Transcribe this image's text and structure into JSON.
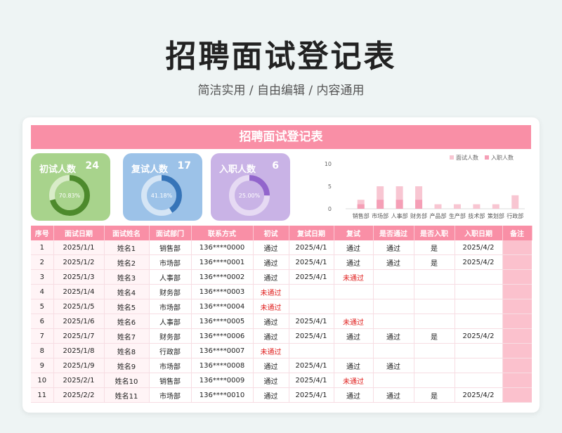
{
  "header": {
    "title": "招聘面试登记表",
    "subtitle": "简洁实用 / 自由编辑 / 内容通用"
  },
  "sheet": {
    "title": "招聘面试登记表"
  },
  "stats": [
    {
      "label": "初试人数",
      "value": "24",
      "percent_text": "70.83%",
      "fraction": 0.7083,
      "color": "#a8d38c",
      "ring": "#4d8a2c",
      "track": "#d9ecc9"
    },
    {
      "label": "复试人数",
      "value": "17",
      "percent_text": "41.18%",
      "fraction": 0.4118,
      "color": "#9cc2e8",
      "ring": "#3674b8",
      "track": "#d5e5f5"
    },
    {
      "label": "入职人数",
      "value": "6",
      "percent_text": "25.00%",
      "fraction": 0.25,
      "color": "#c9b3e6",
      "ring": "#9265cc",
      "track": "#e6daf3"
    }
  ],
  "chart_data": {
    "type": "bar",
    "categories": [
      "销售部",
      "市场部",
      "人事部",
      "财务部",
      "产品部",
      "生产部",
      "技术部",
      "策划部",
      "行政部"
    ],
    "series": [
      {
        "name": "面试人数",
        "values": [
          2,
          5,
          5,
          5,
          1,
          1,
          1,
          1,
          3
        ],
        "color": "#f8c6d2"
      },
      {
        "name": "入职人数",
        "values": [
          1,
          2,
          2,
          2,
          0,
          0,
          0,
          0,
          0
        ],
        "color": "#f59fb6"
      }
    ],
    "yticks": [
      "10",
      "5",
      "0"
    ],
    "ylim": [
      0,
      10
    ],
    "legend": "top-right"
  },
  "table": {
    "columns": [
      "序号",
      "面试日期",
      "面试姓名",
      "面试部门",
      "联系方式",
      "初试",
      "复试日期",
      "复试",
      "是否通过",
      "是否入职",
      "入职日期",
      "备注"
    ],
    "rows": [
      [
        "1",
        "2025/1/1",
        "姓名1",
        "销售部",
        "136****0000",
        "通过",
        "2025/4/1",
        "通过",
        "通过",
        "是",
        "2025/4/2",
        ""
      ],
      [
        "2",
        "2025/1/2",
        "姓名2",
        "市场部",
        "136****0001",
        "通过",
        "2025/4/1",
        "通过",
        "通过",
        "是",
        "2025/4/2",
        ""
      ],
      [
        "3",
        "2025/1/3",
        "姓名3",
        "人事部",
        "136****0002",
        "通过",
        "2025/4/1",
        "未通过",
        "",
        "",
        "",
        ""
      ],
      [
        "4",
        "2025/1/4",
        "姓名4",
        "财务部",
        "136****0003",
        "未通过",
        "",
        "",
        "",
        "",
        "",
        ""
      ],
      [
        "5",
        "2025/1/5",
        "姓名5",
        "市场部",
        "136****0004",
        "未通过",
        "",
        "",
        "",
        "",
        "",
        ""
      ],
      [
        "6",
        "2025/1/6",
        "姓名6",
        "人事部",
        "136****0005",
        "通过",
        "2025/4/1",
        "未通过",
        "",
        "",
        "",
        ""
      ],
      [
        "7",
        "2025/1/7",
        "姓名7",
        "财务部",
        "136****0006",
        "通过",
        "2025/4/1",
        "通过",
        "通过",
        "是",
        "2025/4/2",
        ""
      ],
      [
        "8",
        "2025/1/8",
        "姓名8",
        "行政部",
        "136****0007",
        "未通过",
        "",
        "",
        "",
        "",
        "",
        ""
      ],
      [
        "9",
        "2025/1/9",
        "姓名9",
        "市场部",
        "136****0008",
        "通过",
        "2025/4/1",
        "通过",
        "通过",
        "",
        "",
        ""
      ],
      [
        "10",
        "2025/2/1",
        "姓名10",
        "销售部",
        "136****0009",
        "通过",
        "2025/4/1",
        "未通过",
        "",
        "",
        "",
        ""
      ],
      [
        "11",
        "2025/2/2",
        "姓名11",
        "市场部",
        "136****0010",
        "通过",
        "2025/4/1",
        "通过",
        "通过",
        "是",
        "2025/4/2",
        ""
      ]
    ]
  }
}
